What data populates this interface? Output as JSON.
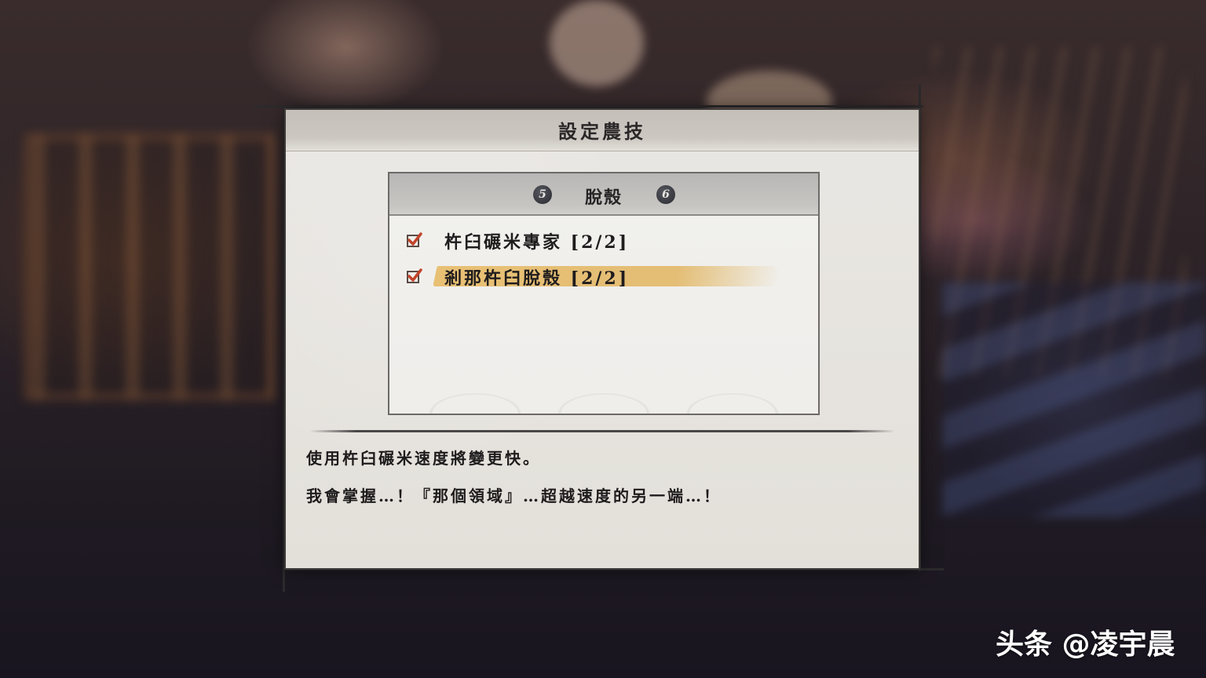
{
  "dialog": {
    "title": "設定農技"
  },
  "panel": {
    "page_prev": "5",
    "page_next": "6",
    "category": "脫殼",
    "skills": [
      {
        "label": "杵臼碾米專家 [2/2]",
        "checked": true,
        "selected": false
      },
      {
        "label": "剎那杵臼脫殼 [2/2]",
        "checked": true,
        "selected": true
      }
    ]
  },
  "description": {
    "effect": "使用杵臼碾米速度將變更快。",
    "flavor": "我會掌握…！『那個領域』…超越速度的另一端…！"
  },
  "watermark": "头条 @凌宇晨",
  "colors": {
    "check_mark": "#c2442a",
    "highlight": "#e2b868"
  },
  "icons": {
    "page_badge": "circle-number-badge",
    "check": "checkmark-icon"
  }
}
